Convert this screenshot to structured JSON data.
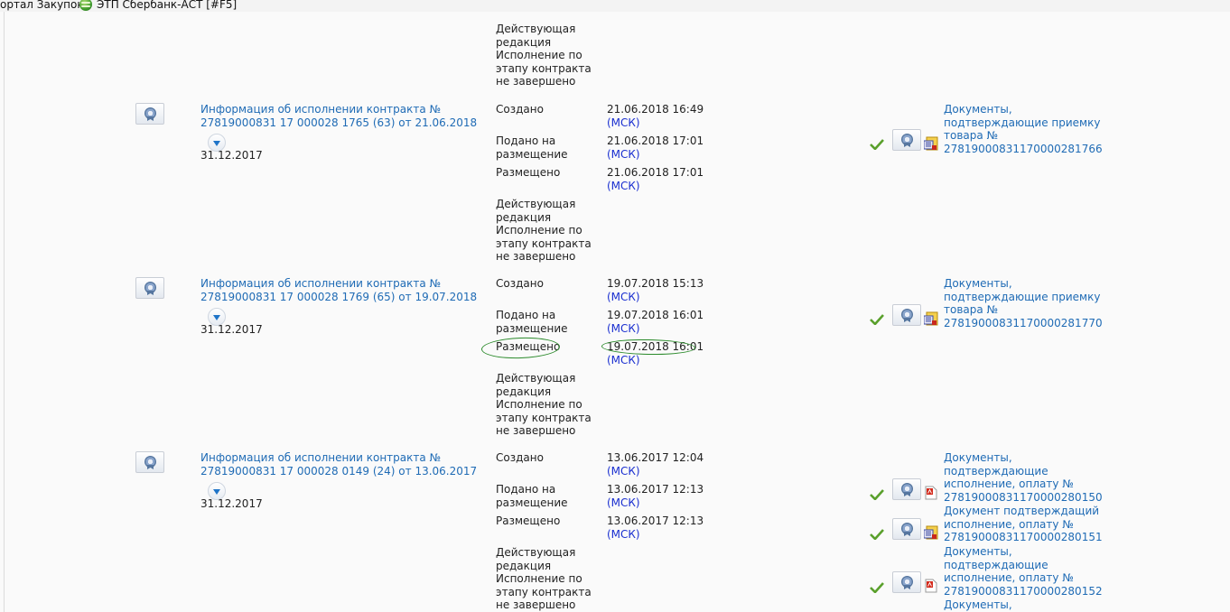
{
  "bookmarks": {
    "items": [
      "ортал Закупок",
      "ЭТП Сбербанк-АСТ [#F5]"
    ]
  },
  "group_top": {
    "lines": [
      "Действующая",
      "редакция",
      "Исполнение по",
      "этапу контракта",
      "не завершено"
    ]
  },
  "records": [
    {
      "title": [
        "Информация об исполнении контракта №",
        "27819000831 17 000028 1765 (63) от 21.06.2018"
      ],
      "date": "31.12.2017",
      "events": [
        {
          "label": [
            "Создано"
          ],
          "time": "21.06.2018 16:49",
          "tz": "(МСК)"
        },
        {
          "label": [
            "Подано на",
            "размещение"
          ],
          "time": "21.06.2018 17:01",
          "tz": "(МСК)"
        },
        {
          "label": [
            "Размещено"
          ],
          "time": "21.06.2018 17:01",
          "tz": "(МСК)"
        }
      ],
      "status": [
        "Действующая",
        "редакция",
        "Исполнение по",
        "этапу контракта",
        "не завершено"
      ],
      "docs": [
        {
          "lines": [
            "Документы,",
            "подтверждающие приемку",
            "товара №",
            "27819000831170000281766"
          ]
        }
      ]
    },
    {
      "title": [
        "Информация об исполнении контракта №",
        "27819000831 17 000028 1769 (65) от 19.07.2018"
      ],
      "date": "31.12.2017",
      "events": [
        {
          "label": [
            "Создано"
          ],
          "time": "19.07.2018 15:13",
          "tz": "(МСК)"
        },
        {
          "label": [
            "Подано на",
            "размещение"
          ],
          "time": "19.07.2018 16:01",
          "tz": "(МСК)"
        },
        {
          "label": [
            "Размещено"
          ],
          "time": "19.07.2018 16:01",
          "tz": "(МСК)"
        }
      ],
      "status": [
        "Действующая",
        "редакция",
        "Исполнение по",
        "этапу контракта",
        "не завершено"
      ],
      "docs": [
        {
          "lines": [
            "Документы,",
            "подтверждающие приемку",
            "товара №",
            "27819000831170000281770"
          ]
        }
      ]
    },
    {
      "title": [
        "Информация об исполнении контракта №",
        "27819000831 17 000028 0149 (24) от 13.06.2017"
      ],
      "date": "31.12.2017",
      "events": [
        {
          "label": [
            "Создано"
          ],
          "time": "13.06.2017 12:04",
          "tz": "(МСК)"
        },
        {
          "label": [
            "Подано на",
            "размещение"
          ],
          "time": "13.06.2017 12:13",
          "tz": "(МСК)"
        },
        {
          "label": [
            "Размещено"
          ],
          "time": "13.06.2017 12:13",
          "tz": "(МСК)"
        }
      ],
      "status": [
        "Действующая",
        "редакция",
        "Исполнение по",
        "этапу контракта",
        "не завершено"
      ],
      "docs": [
        {
          "lines": [
            "Документы,",
            "подтверждающие",
            "исполнение, оплату №",
            "27819000831170000280150"
          ]
        },
        {
          "lines": [
            "Документ подтверждащий",
            "исполнение, оплату №",
            "27819000831170000280151"
          ]
        },
        {
          "lines": [
            "Документы,",
            "подтверждающие",
            "исполнение, оплату №",
            "27819000831170000280152"
          ]
        },
        {
          "lines": [
            "Документы,"
          ]
        }
      ]
    }
  ]
}
